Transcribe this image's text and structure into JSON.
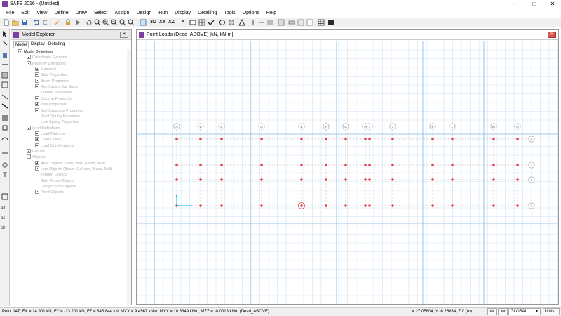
{
  "window": {
    "title": "SAFE 2016 - (Untitled)",
    "minimize": "–",
    "maximize": "□",
    "close": "✕"
  },
  "menu": [
    "File",
    "Edit",
    "View",
    "Define",
    "Draw",
    "Select",
    "Assign",
    "Design",
    "Run",
    "Display",
    "Detailing",
    "Tools",
    "Options",
    "Help"
  ],
  "toolbar": {
    "view_3d": "3D",
    "view_xy": "XY",
    "view_xz": "XZ"
  },
  "left_tools": {
    "all": "all",
    "ps": "ps",
    "clr": "clr"
  },
  "explorer": {
    "title": "Model Explorer",
    "close": "✕",
    "tabs": [
      "Model",
      "Display",
      "Detailing"
    ],
    "tree": [
      {
        "label": "Model Definitions",
        "level": 0,
        "toggle": "minus",
        "root": true
      },
      {
        "label": "Coordinate Systems",
        "level": 1,
        "toggle": "plus"
      },
      {
        "label": "Property Definitions",
        "level": 1,
        "toggle": "minus"
      },
      {
        "label": "Materials",
        "level": 2,
        "toggle": "plus"
      },
      {
        "label": "Slab Properties",
        "level": 2,
        "toggle": "plus"
      },
      {
        "label": "Beam Properties",
        "level": 2,
        "toggle": "plus"
      },
      {
        "label": "Reinforcing Bar Sizes",
        "level": 2,
        "toggle": "plus"
      },
      {
        "label": "Tendon Properties",
        "level": 2,
        "toggle": "leaf"
      },
      {
        "label": "Column Properties",
        "level": 2,
        "toggle": "plus"
      },
      {
        "label": "Wall Properties",
        "level": 2,
        "toggle": "plus"
      },
      {
        "label": "Soil Subgrade Properties",
        "level": 2,
        "toggle": "plus"
      },
      {
        "label": "Point Spring Properties",
        "level": 2,
        "toggle": "leaf"
      },
      {
        "label": "Line Spring Properties",
        "level": 2,
        "toggle": "leaf"
      },
      {
        "label": "Load Definitions",
        "level": 1,
        "toggle": "minus"
      },
      {
        "label": "Load Patterns",
        "level": 2,
        "toggle": "plus"
      },
      {
        "label": "Load Cases",
        "level": 2,
        "toggle": "plus"
      },
      {
        "label": "Load Combinations",
        "level": 2,
        "toggle": "plus"
      },
      {
        "label": "Groups",
        "level": 1,
        "toggle": "plus"
      },
      {
        "label": "Objects",
        "level": 1,
        "toggle": "minus"
      },
      {
        "label": "Area Objects (Slab, Wall, Ramp, Null)",
        "level": 2,
        "toggle": "plus"
      },
      {
        "label": "Line Objects (Beam, Column, Brace, Null)",
        "level": 2,
        "toggle": "plus"
      },
      {
        "label": "Tendon Objects",
        "level": 2,
        "toggle": "leaf"
      },
      {
        "label": "Slab Rebar Objects",
        "level": 2,
        "toggle": "leaf"
      },
      {
        "label": "Design Strip Objects",
        "level": 2,
        "toggle": "leaf"
      },
      {
        "label": "Point Objects",
        "level": 2,
        "toggle": "plus"
      }
    ]
  },
  "canvas": {
    "title": "Point Loads (Dead_ABOVE)  [kN, kN-m]",
    "close": "✕",
    "grid_x_labels": [
      "A",
      "B",
      "C",
      "D",
      "E",
      "F",
      "G",
      "H",
      "I",
      "J",
      "K",
      "L",
      "M",
      "N",
      "O"
    ],
    "grid_y_labels": [
      "4",
      "3",
      "2",
      "1"
    ],
    "colors": {
      "minor_grid": "#cfe4f7",
      "major_grid": "#7fb6ea",
      "points": "#e8383d",
      "grid_line": "#b8b8b8",
      "bubble": "#909090",
      "axis": "#00b4e6"
    }
  },
  "status": {
    "message": "Point 147,  FX = 14.901 kN,  FY = -13.201 kN,  FZ = 845.844 kN,  MXX = 9.4567 kNm,  MYY = 10.6349 kNm,  MZZ = -0.0013 kNm  (Dead_ABOVE)",
    "coordinates": "X 27.05804,  Y -6.25634,  Z 0  (m)",
    "prev": "<<",
    "next": ">>",
    "coord_system": "GLOBAL",
    "units": "Units..."
  }
}
